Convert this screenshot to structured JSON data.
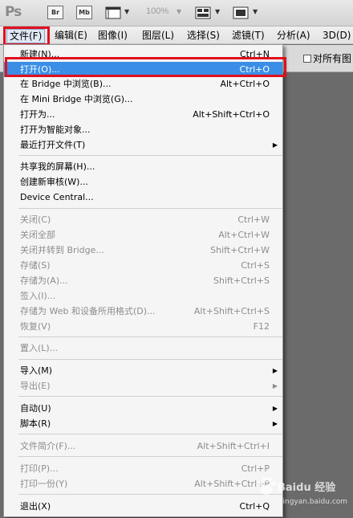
{
  "toolbar": {
    "logo": "Ps",
    "bridge_button": "Br",
    "minibridge_button": "Mb",
    "zoom": "100%"
  },
  "menubar": {
    "items": [
      "文件(F)",
      "编辑(E)",
      "图像(I)",
      "图层(L)",
      "选择(S)",
      "滤镜(T)",
      "分析(A)",
      "3D(D)"
    ]
  },
  "options_bar": {
    "sample_all_layers": "对所有图"
  },
  "file_menu": {
    "items": [
      {
        "label": "新建(N)...",
        "shortcut": "Ctrl+N"
      },
      {
        "label": "打开(O)...",
        "shortcut": "Ctrl+O"
      },
      {
        "label": "在 Bridge 中浏览(B)...",
        "shortcut": "Alt+Ctrl+O"
      },
      {
        "label": "在 Mini Bridge 中浏览(G)...",
        "shortcut": ""
      },
      {
        "label": "打开为...",
        "shortcut": "Alt+Shift+Ctrl+O"
      },
      {
        "label": "打开为智能对象...",
        "shortcut": ""
      },
      {
        "label": "最近打开文件(T)",
        "shortcut": ""
      },
      {
        "label": "共享我的屏幕(H)...",
        "shortcut": ""
      },
      {
        "label": "创建新审核(W)...",
        "shortcut": ""
      },
      {
        "label": "Device Central...",
        "shortcut": ""
      },
      {
        "label": "关闭(C)",
        "shortcut": "Ctrl+W"
      },
      {
        "label": "关闭全部",
        "shortcut": "Alt+Ctrl+W"
      },
      {
        "label": "关闭并转到 Bridge...",
        "shortcut": "Shift+Ctrl+W"
      },
      {
        "label": "存储(S)",
        "shortcut": "Ctrl+S"
      },
      {
        "label": "存储为(A)...",
        "shortcut": "Shift+Ctrl+S"
      },
      {
        "label": "签入(I)...",
        "shortcut": ""
      },
      {
        "label": "存储为 Web 和设备所用格式(D)...",
        "shortcut": "Alt+Shift+Ctrl+S"
      },
      {
        "label": "恢复(V)",
        "shortcut": "F12"
      },
      {
        "label": "置入(L)...",
        "shortcut": ""
      },
      {
        "label": "导入(M)",
        "shortcut": ""
      },
      {
        "label": "导出(E)",
        "shortcut": ""
      },
      {
        "label": "自动(U)",
        "shortcut": ""
      },
      {
        "label": "脚本(R)",
        "shortcut": ""
      },
      {
        "label": "文件简介(F)...",
        "shortcut": "Alt+Shift+Ctrl+I"
      },
      {
        "label": "打印(P)...",
        "shortcut": "Ctrl+P"
      },
      {
        "label": "打印一份(Y)",
        "shortcut": "Alt+Shift+Ctrl+P"
      },
      {
        "label": "退出(X)",
        "shortcut": "Ctrl+Q"
      }
    ]
  },
  "watermark": {
    "text": "Baidu 经验",
    "url": "jingyan.baidu.com"
  }
}
